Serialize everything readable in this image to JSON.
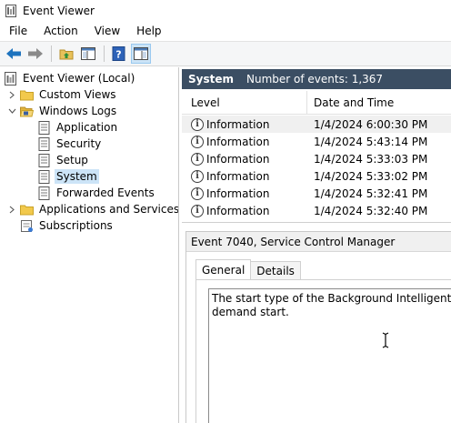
{
  "window": {
    "title": "Event Viewer"
  },
  "menu": [
    "File",
    "Action",
    "View",
    "Help"
  ],
  "toolbar": {
    "buttons": [
      "back-arrow-icon",
      "forward-arrow-icon",
      "up-folder-icon",
      "show-hide-tree-icon",
      "help-icon",
      "show-hide-action-pane-icon"
    ]
  },
  "tree": {
    "root": "Event Viewer (Local)",
    "custom_views": "Custom Views",
    "windows_logs": "Windows Logs",
    "logs": [
      "Application",
      "Security",
      "Setup",
      "System",
      "Forwarded Events"
    ],
    "selected": "System",
    "apps_services": "Applications and Services Lo",
    "subscriptions": "Subscriptions"
  },
  "header": {
    "title": "System",
    "count_label": "Number of events: 1,367",
    "color": "#3b4e63"
  },
  "grid": {
    "columns": [
      "Level",
      "Date and Time"
    ],
    "rows": [
      {
        "level": "Information",
        "date": "1/4/2024 6:00:30 PM"
      },
      {
        "level": "Information",
        "date": "1/4/2024 5:43:14 PM"
      },
      {
        "level": "Information",
        "date": "1/4/2024 5:33:03 PM"
      },
      {
        "level": "Information",
        "date": "1/4/2024 5:33:02 PM"
      },
      {
        "level": "Information",
        "date": "1/4/2024 5:32:41 PM"
      },
      {
        "level": "Information",
        "date": "1/4/2024 5:32:40 PM"
      }
    ]
  },
  "detail": {
    "title": "Event 7040, Service Control Manager",
    "tabs": [
      "General",
      "Details"
    ],
    "active_tab": "General",
    "description_lines": [
      "The start type of the Background Intelligent Transf",
      "demand start."
    ]
  }
}
